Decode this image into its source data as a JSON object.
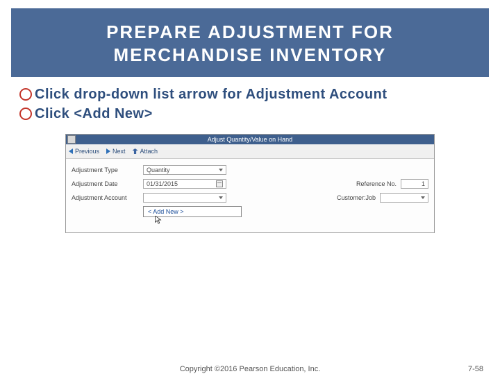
{
  "title_line1": "PREPARE ADJUSTMENT FOR",
  "title_line2": "MERCHANDISE INVENTORY",
  "bullets": {
    "b1": "Click drop-down list arrow for Adjustment Account",
    "b2": "Click <Add New>"
  },
  "qb": {
    "window_title": "Adjust Quantity/Value on Hand",
    "toolbar": {
      "previous": "Previous",
      "next": "Next",
      "attach": "Attach"
    },
    "rows": {
      "adj_type_label": "Adjustment Type",
      "adj_type_value": "Quantity",
      "adj_date_label": "Adjustment Date",
      "adj_date_value": "01/31/2015",
      "ref_label": "Reference No.",
      "ref_value": "1",
      "adj_account_label": "Adjustment Account",
      "cust_label": "Customer:Job"
    },
    "dropdown_item": "< Add New >"
  },
  "footer": {
    "copyright": "Copyright ©2016 Pearson Education, Inc.",
    "page": "7-58"
  }
}
